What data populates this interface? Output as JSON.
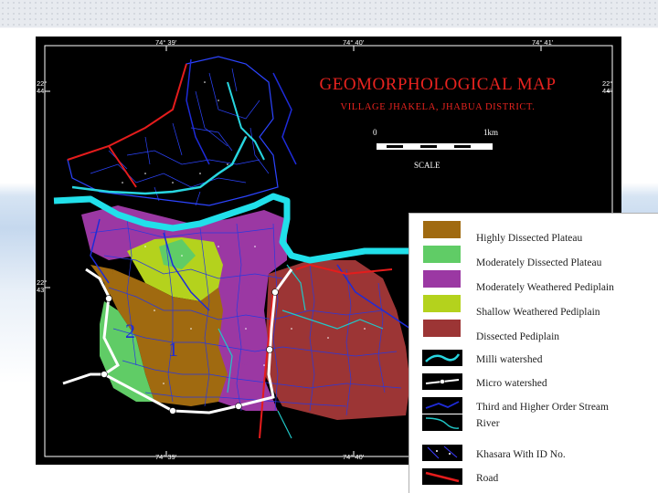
{
  "map": {
    "title": "GEOMORPHOLOGICAL MAP",
    "subtitle": "VILLAGE JHAKELA, JHABUA DISTRICT.",
    "scale": {
      "start_label": "0",
      "end_label": "1km",
      "caption": "SCALE"
    },
    "coordinates": {
      "top": [
        "74° 39'",
        "74° 40'",
        "74° 41'"
      ],
      "bottom": [
        "74° 39'",
        "74° 40'"
      ],
      "left": [
        "22°\n44'",
        "22°\n43'"
      ],
      "right": [
        "22°\n44'"
      ]
    },
    "zone_labels": [
      "2",
      "1"
    ]
  },
  "legend": {
    "items": [
      {
        "label": "Highly Dissected Plateau",
        "color": "#a06a10",
        "kind": "fill"
      },
      {
        "label": "Moderately Dissected Plateau",
        "color": "#60cc66",
        "kind": "fill"
      },
      {
        "label": "Moderately Weathered Pediplain",
        "color": "#9b38a3",
        "kind": "fill"
      },
      {
        "label": "Shallow Weathered Pediplain",
        "color": "#b4d21d",
        "kind": "fill"
      },
      {
        "label": "Dissected Pediplain",
        "color": "#9c3535",
        "kind": "fill"
      },
      {
        "label": "Milli watershed",
        "color": "#28d6e0",
        "kind": "line"
      },
      {
        "label": "Micro watershed",
        "color": "#ffffff",
        "kind": "line-dots"
      },
      {
        "label": "Third and Higher Order Stream",
        "color": "#1e2bd8",
        "kind": "line"
      },
      {
        "label": "River",
        "color": "#21c8c8",
        "kind": "line-thin"
      },
      {
        "label": "Khasara With ID No.",
        "color": "#3b3bff",
        "kind": "dots"
      },
      {
        "label": "Road",
        "color": "#e51c1c",
        "kind": "line-thick"
      }
    ]
  }
}
